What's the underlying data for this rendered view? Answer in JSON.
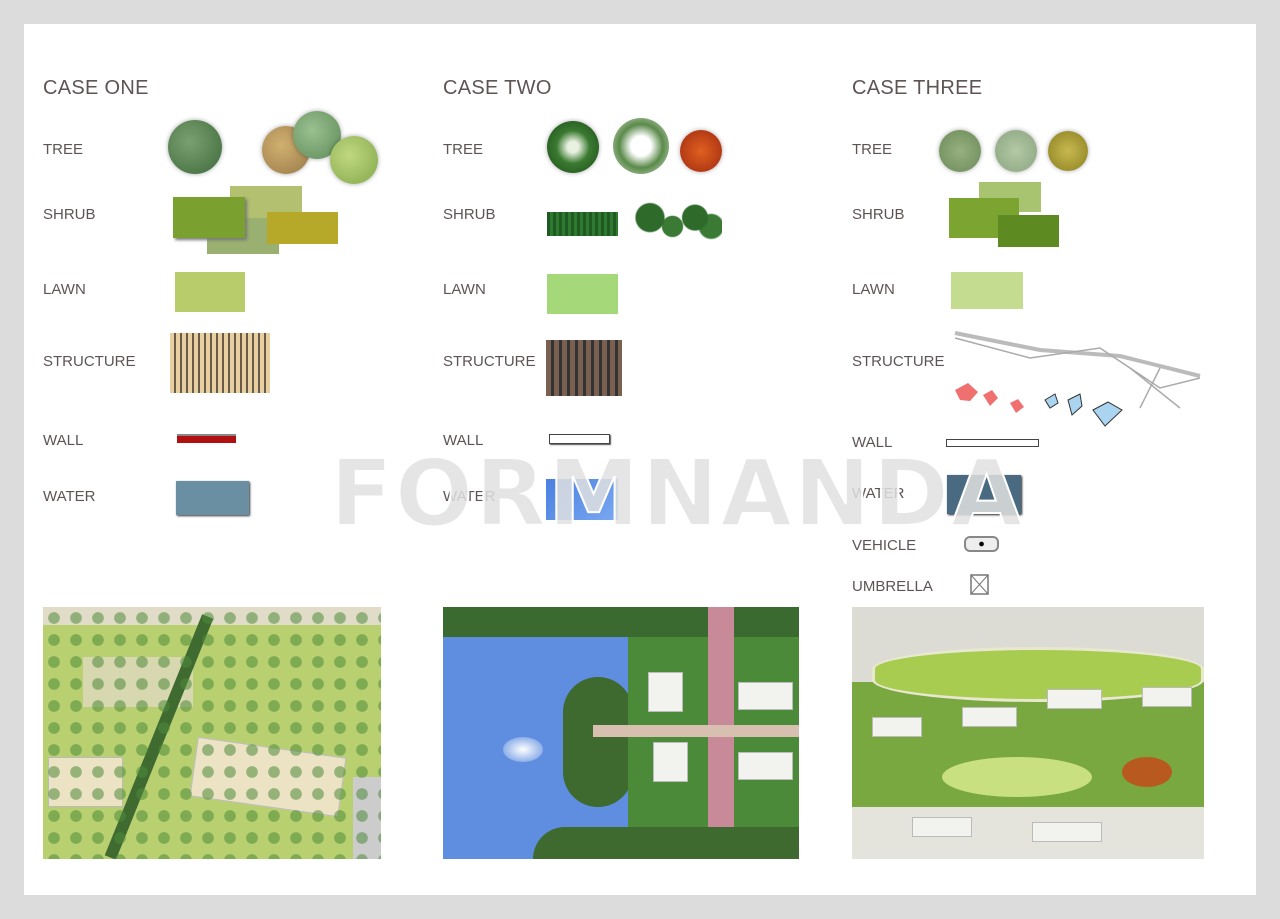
{
  "watermark": "FORMNANDA",
  "cases": [
    {
      "title": "CASE ONE",
      "labels": {
        "tree": "TREE",
        "shrub": "SHRUB",
        "lawn": "LAWN",
        "structure": "STRUCTURE",
        "wall": "WALL",
        "water": "WATER"
      }
    },
    {
      "title": "CASE TWO",
      "labels": {
        "tree": "TREE",
        "shrub": "SHRUB",
        "lawn": "LAWN",
        "structure": "STRUCTURE",
        "wall": "WALL",
        "water": "WATER"
      }
    },
    {
      "title": "CASE THREE",
      "labels": {
        "tree": "TREE",
        "shrub": "SHRUB",
        "lawn": "LAWN",
        "structure": "STRUCTURE",
        "wall": "WALL",
        "water": "WATER",
        "vehicle": "VEHICLE",
        "umbrella": "UMBRELLA"
      }
    }
  ],
  "colors": {
    "background": "#dcdcdc",
    "sheet": "#ffffff",
    "text": "#5e5454",
    "water1": "#6a8fa3",
    "water2": "#5b8fe0",
    "water3": "#4a6a82",
    "wall1": "#b01010"
  }
}
